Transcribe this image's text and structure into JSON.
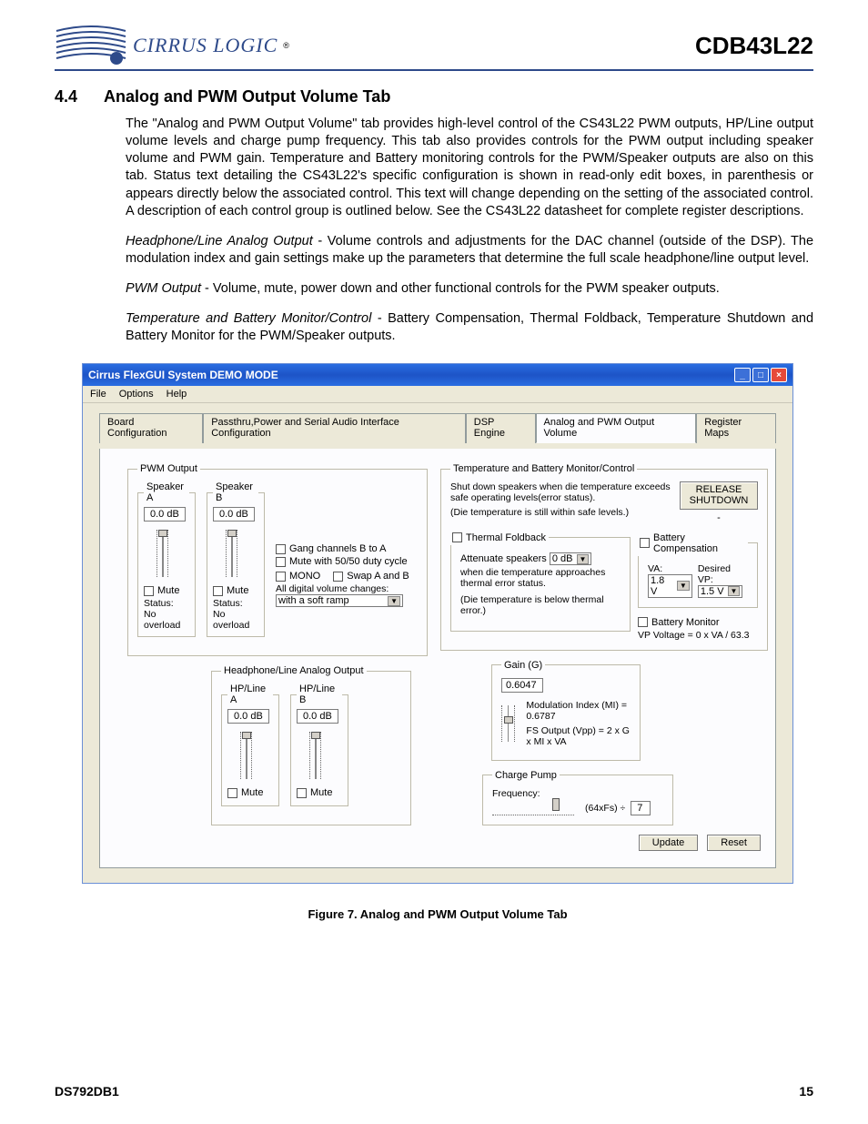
{
  "header": {
    "brand": "CIRRUS LOGIC",
    "docid": "CDB43L22"
  },
  "section": {
    "num": "4.4",
    "title": "Analog and PWM Output Volume Tab"
  },
  "para1": "The \"Analog and PWM Output Volume\" tab provides high-level control of the CS43L22 PWM outputs, HP/Line output volume levels and charge pump frequency. This tab also provides controls for the PWM output including speaker volume and PWM gain. Temperature and Battery monitoring controls for the PWM/Speaker outputs are also on this tab. Status text detailing the CS43L22's specific configuration is shown in read-only edit boxes, in parenthesis or appears directly below the associated control. This text will change depending on the setting of the associated control. A description of each control group is outlined below. See the CS43L22 datasheet for complete register descriptions.",
  "para2a": "Headphone/Line Analog Output",
  "para2b": " - Volume controls and adjustments for the DAC channel (outside of the DSP). The modulation index and gain settings make up the parameters that determine the full scale headphone/line output level.",
  "para3a": "PWM Output",
  "para3b": " - Volume, mute, power down and other functional controls for the PWM speaker outputs.",
  "para4a": "Temperature and Battery Monitor/Control",
  "para4b": " - Battery Compensation, Thermal Foldback, Temperature Shutdown and Battery Monitor for the PWM/Speaker outputs.",
  "gui": {
    "title": "Cirrus FlexGUI System DEMO MODE",
    "menu": {
      "file": "File",
      "options": "Options",
      "help": "Help"
    },
    "tabs": {
      "t1": "Board Configuration",
      "t2": "Passthru,Power and Serial Audio Interface Configuration",
      "t3": "DSP Engine",
      "t4": "Analog and PWM Output Volume",
      "t5": "Register Maps"
    },
    "pwm": {
      "legend": "PWM Output",
      "spA": "Speaker A",
      "spB": "Speaker B",
      "valA": "0.0 dB",
      "valB": "0.0 dB",
      "muteA": "Mute",
      "muteB": "Mute",
      "statusA_lbl": "Status:",
      "statusA_val": "No overload",
      "statusB_lbl": "Status:",
      "statusB_val": "No overload",
      "gang": "Gang channels B to A",
      "m5050": "Mute with 50/50 duty cycle",
      "mono": "MONO",
      "swap": "Swap A and B",
      "digvol": "All digital volume changes:",
      "ramp": "with a soft ramp"
    },
    "hp": {
      "legend": "Headphone/Line Analog Output",
      "hpA": "HP/Line A",
      "hpB": "HP/Line B",
      "valA": "0.0 dB",
      "valB": "0.0 dB",
      "muteA": "Mute",
      "muteB": "Mute"
    },
    "temp": {
      "legend": "Temperature and Battery Monitor/Control",
      "line1": "Shut down speakers when die temperature exceeds safe operating levels(error status).",
      "line2": "(Die temperature is still within safe levels.)",
      "release": "RELEASE SHUTDOWN",
      "tf_legend": "Thermal Foldback",
      "tf_att": "Attenuate speakers",
      "tf_val": "0 dB",
      "tf_when": "when die temperature approaches thermal error status.",
      "tf_note": "(Die temperature is below thermal error.)",
      "bc_legend": "Battery Compensation",
      "va_lbl": "VA:",
      "va_val": "1.8 V",
      "vp_lbl": "Desired VP:",
      "vp_val": "1.5 V",
      "bm_chk": "Battery Monitor",
      "bm_line": "VP Voltage =   0  x VA / 63.3"
    },
    "gain": {
      "legend": "Gain (G)",
      "val": "0.6047",
      "mi": "Modulation Index (MI) = 0.6787",
      "fs": "FS Output (Vpp) = 2 x G x MI x VA"
    },
    "cp": {
      "legend": "Charge Pump",
      "freq": "Frequency:",
      "unit": "(64xFs) ÷",
      "div": "7"
    },
    "buttons": {
      "update": "Update",
      "reset": "Reset"
    }
  },
  "figcap": "Figure 7.  Analog and PWM Output Volume Tab",
  "footer": {
    "left": "DS792DB1",
    "right": "15"
  }
}
